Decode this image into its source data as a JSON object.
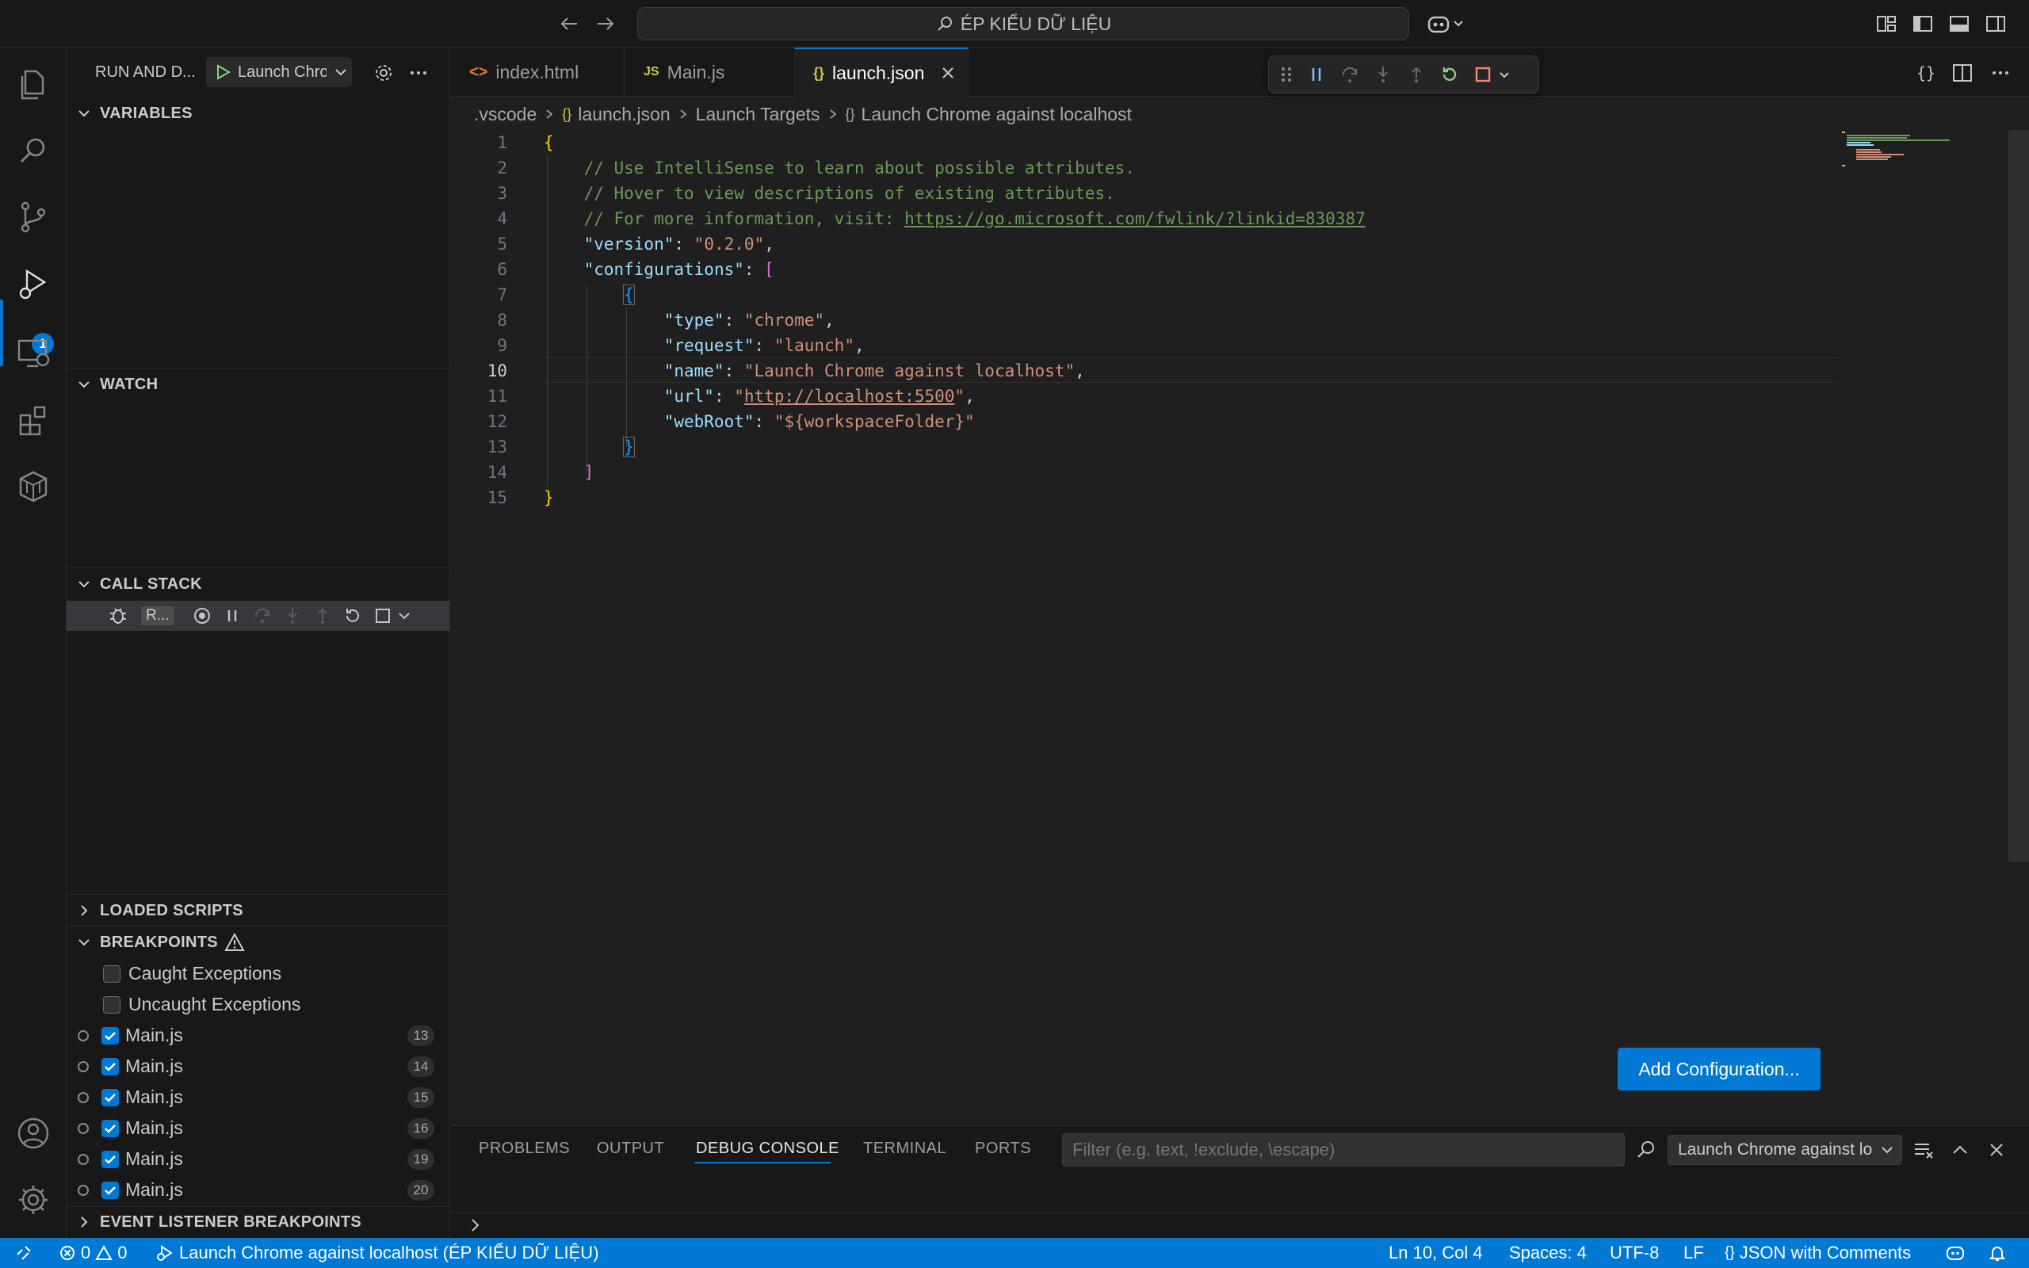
{
  "titlebar": {
    "search_label": "ÉP KIỂU DỮ LIỆU"
  },
  "activity": {
    "debug_badge": "1"
  },
  "sidebar": {
    "title": "RUN AND D...",
    "launch_config": "Launch Chro",
    "sections": {
      "variables": "VARIABLES",
      "watch": "WATCH",
      "call_stack": "CALL STACK",
      "loaded_scripts": "LOADED SCRIPTS",
      "breakpoints": "BREAKPOINTS",
      "event_listener": "EVENT LISTENER BREAKPOINTS"
    },
    "call_stack_session": "R...",
    "breakpoints": {
      "caught": "Caught Exceptions",
      "uncaught": "Uncaught Exceptions",
      "items": [
        {
          "file": "Main.js",
          "line": "13"
        },
        {
          "file": "Main.js",
          "line": "14"
        },
        {
          "file": "Main.js",
          "line": "15"
        },
        {
          "file": "Main.js",
          "line": "16"
        },
        {
          "file": "Main.js",
          "line": "19"
        },
        {
          "file": "Main.js",
          "line": "20"
        }
      ]
    }
  },
  "tabs": [
    {
      "label": "index.html",
      "icon": "html-file-icon"
    },
    {
      "label": "Main.js",
      "icon": "js-file-icon"
    },
    {
      "label": "launch.json",
      "icon": "json-file-icon"
    }
  ],
  "breadcrumb": {
    "folder": ".vscode",
    "file": "launch.json",
    "section": "Launch Targets",
    "item": "Launch Chrome against localhost"
  },
  "code": {
    "line_numbers": [
      "1",
      "2",
      "3",
      "4",
      "5",
      "6",
      "7",
      "8",
      "9",
      "10",
      "11",
      "12",
      "13",
      "14",
      "15"
    ],
    "current_line": "10",
    "comment1": "// Use IntelliSense to learn about possible attributes.",
    "comment2": "// Hover to view descriptions of existing attributes.",
    "comment3": "// For more information, visit: ",
    "comment3_link": "https://go.microsoft.com/fwlink/?linkid=830387",
    "version_key": "\"version\"",
    "version_val": "\"0.2.0\"",
    "configs_key": "\"configurations\"",
    "type_key": "\"type\"",
    "type_val": "\"chrome\"",
    "request_key": "\"request\"",
    "request_val": "\"launch\"",
    "name_key": "\"name\"",
    "name_val": "\"Launch Chrome against localhost\"",
    "url_key": "\"url\"",
    "url_val": "http://localhost:5500",
    "webroot_key": "\"webRoot\"",
    "webroot_val": "\"${workspaceFolder}\""
  },
  "add_configuration": "Add Configuration...",
  "panel": {
    "tabs": [
      "PROBLEMS",
      "OUTPUT",
      "DEBUG CONSOLE",
      "TERMINAL",
      "PORTS"
    ],
    "active_tab": "DEBUG CONSOLE",
    "filter_placeholder": "Filter (e.g. text, !exclude, \\escape)",
    "session": "Launch Chrome against lo"
  },
  "statusbar": {
    "errors": "0",
    "warnings": "0",
    "debug_session": "Launch Chrome against localhost (ÉP KIỂU DỮ LIỆU)",
    "position": "Ln 10, Col 4",
    "spaces": "Spaces: 4",
    "encoding": "UTF-8",
    "eol": "LF",
    "language": "JSON with Comments"
  },
  "colors": {
    "accent": "#0078d4",
    "background": "#1f1f1f",
    "sidebar": "#181818"
  }
}
